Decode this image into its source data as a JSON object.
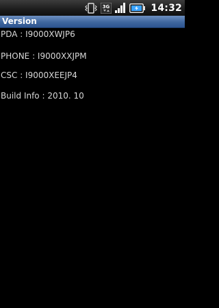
{
  "status_bar": {
    "icons": [
      "vibrate-icon",
      "network-3g-icon",
      "signal-icon",
      "battery-charging-icon"
    ],
    "network_label": "3G",
    "time": "14:32"
  },
  "title_bar": {
    "title": "Version"
  },
  "info": [
    {
      "text": "PDA : I9000XWJP6"
    },
    {
      "text": "PHONE : I9000XXJPM"
    },
    {
      "text": "CSC : I9000XEEJP4"
    },
    {
      "text": "Build Info : 2010. 10"
    }
  ],
  "colors": {
    "background": "#000000",
    "title_bar": "#3f679f",
    "text": "#d8d8d8",
    "status_text": "#ffffff"
  }
}
